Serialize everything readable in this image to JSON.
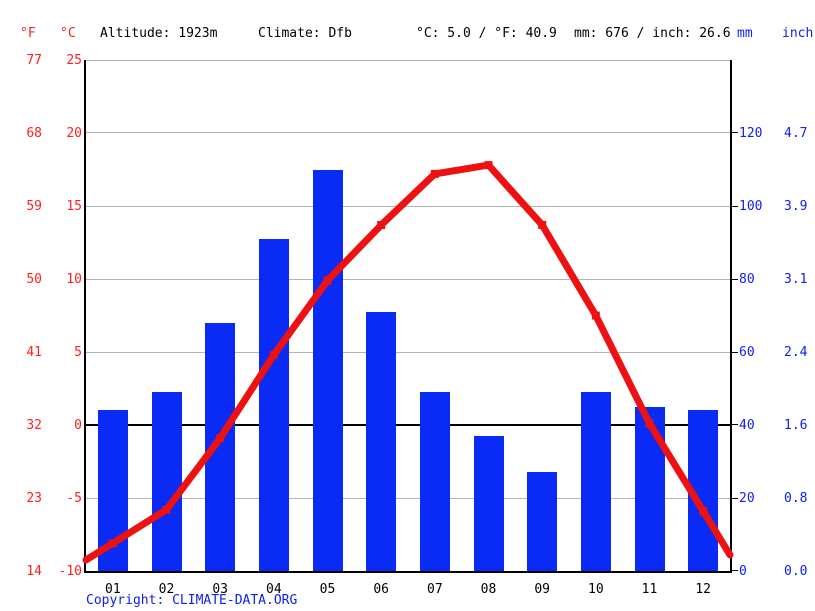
{
  "header": {
    "unit_f": "°F",
    "unit_c": "°C",
    "altitude": "Altitude: 1923m",
    "climate": "Climate: Dfb",
    "avg_temp": "°C: 5.0 / °F: 40.9",
    "avg_precip": "mm: 676 / inch: 26.6",
    "unit_mm": "mm",
    "unit_inch": "inch"
  },
  "copyright": "Copyright: CLIMATE-DATA.ORG",
  "axes": {
    "left_f_ticks": [
      "77",
      "68",
      "59",
      "50",
      "41",
      "32",
      "23",
      "14"
    ],
    "left_c_ticks": [
      "25",
      "20",
      "15",
      "10",
      "5",
      "0",
      "-5",
      "-10"
    ],
    "right_mm_ticks": [
      "",
      "120",
      "100",
      "80",
      "60",
      "40",
      "20",
      "0"
    ],
    "right_inch_ticks": [
      "",
      "4.7",
      "3.9",
      "3.1",
      "2.4",
      "1.6",
      "0.8",
      "0.0"
    ]
  },
  "colors": {
    "precipitation": "#0a2bf5",
    "temperature": "#ee1111",
    "gridline": "#b4b4b4",
    "axis": "#000000"
  },
  "chart_data": {
    "type": "bar",
    "title": "Climate graph // Weather by Month",
    "categories": [
      "01",
      "02",
      "03",
      "04",
      "05",
      "06",
      "07",
      "08",
      "09",
      "10",
      "11",
      "12"
    ],
    "series": [
      {
        "name": "Precipitation (mm)",
        "type": "bar",
        "axis": "right",
        "values": [
          44,
          49,
          68,
          91,
          110,
          71,
          49,
          37,
          27,
          49,
          45,
          44
        ]
      },
      {
        "name": "Temperature (°C)",
        "type": "line",
        "axis": "left",
        "values": [
          -8.1,
          -5.8,
          -0.9,
          4.8,
          9.9,
          13.7,
          17.2,
          17.8,
          13.7,
          7.5,
          0.1,
          -5.9
        ]
      }
    ],
    "xlabel": "",
    "ylabel_left": "°C",
    "ylabel_left_secondary": "°F",
    "ylabel_right": "mm",
    "ylabel_right_secondary": "inch",
    "ylim_left_c": [
      -10,
      25
    ],
    "ylim_left_f": [
      14,
      77
    ],
    "ylim_right_mm": [
      0,
      140
    ],
    "ylim_right_inch": [
      0.0,
      5.5
    ],
    "grid": true,
    "legend": "none"
  }
}
